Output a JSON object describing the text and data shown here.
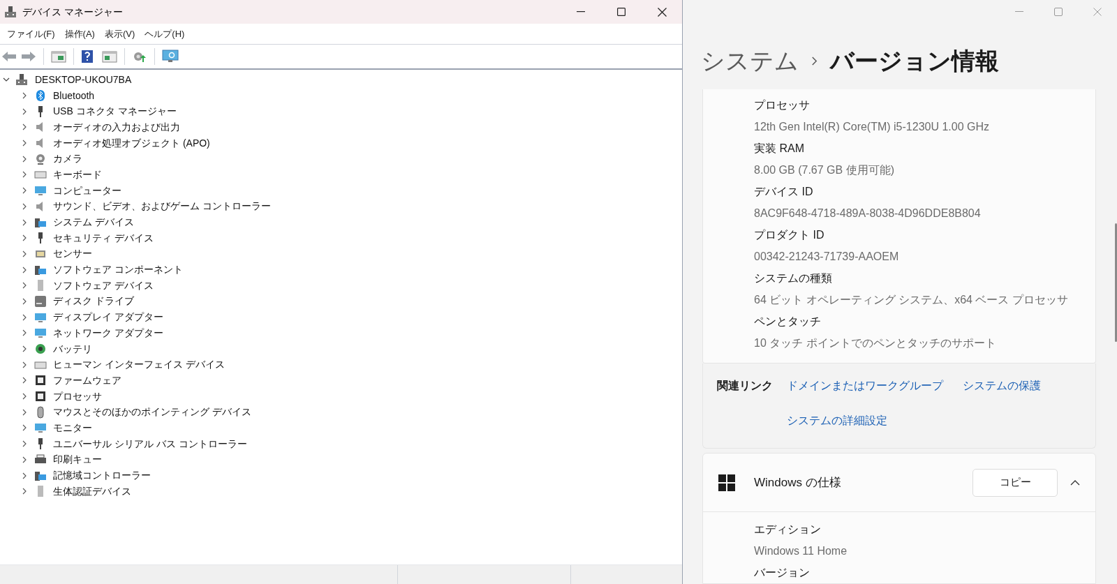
{
  "device_manager": {
    "window": {
      "title": "デバイス マネージャー"
    },
    "menu": [
      "ファイル(F)",
      "操作(A)",
      "表示(V)",
      "ヘルプ(H)"
    ],
    "tree": {
      "label": "DESKTOP-UKOU7BA",
      "expanded": true,
      "children": [
        {
          "label": "Bluetooth",
          "expanded": false
        },
        {
          "label": "USB コネクタ マネージャー",
          "expanded": false
        },
        {
          "label": "オーディオの入力および出力",
          "expanded": false
        },
        {
          "label": "オーディオ処理オブジェクト (APO)",
          "expanded": false
        },
        {
          "label": "カメラ",
          "expanded": false
        },
        {
          "label": "キーボード",
          "expanded": false
        },
        {
          "label": "コンピューター",
          "expanded": false
        },
        {
          "label": "サウンド、ビデオ、およびゲーム コントローラー",
          "expanded": false
        },
        {
          "label": "システム デバイス",
          "expanded": false
        },
        {
          "label": "セキュリティ デバイス",
          "expanded": false
        },
        {
          "label": "センサー",
          "expanded": false
        },
        {
          "label": "ソフトウェア コンポーネント",
          "expanded": false
        },
        {
          "label": "ソフトウェア デバイス",
          "expanded": false
        },
        {
          "label": "ディスク ドライブ",
          "expanded": false
        },
        {
          "label": "ディスプレイ アダプター",
          "expanded": false
        },
        {
          "label": "ネットワーク アダプター",
          "expanded": false
        },
        {
          "label": "バッテリ",
          "expanded": false
        },
        {
          "label": "ヒューマン インターフェイス デバイス",
          "expanded": false
        },
        {
          "label": "ファームウェア",
          "expanded": false
        },
        {
          "label": "プロセッサ",
          "expanded": false
        },
        {
          "label": "マウスとそのほかのポインティング デバイス",
          "expanded": false
        },
        {
          "label": "モニター",
          "expanded": false
        },
        {
          "label": "ユニバーサル シリアル バス コントローラー",
          "expanded": false
        },
        {
          "label": "印刷キュー",
          "expanded": false
        },
        {
          "label": "記憶域コントローラー",
          "expanded": false
        },
        {
          "label": "生体認証デバイス",
          "expanded": false
        }
      ]
    }
  },
  "settings": {
    "breadcrumb": [
      "システム",
      "バージョン情報"
    ],
    "device_specs": [
      {
        "label": "プロセッサ",
        "value": "12th Gen Intel(R) Core(TM) i5-1230U   1.00 GHz"
      },
      {
        "label": "実装 RAM",
        "value": "8.00 GB (7.67 GB 使用可能)"
      },
      {
        "label": "デバイス ID",
        "value": "8AC9F648-4718-489A-8038-4D96DDE8B804"
      },
      {
        "label": "プロダクト ID",
        "value": "00342-21243-71739-AAOEM"
      },
      {
        "label": "システムの種類",
        "value": "64 ビット オペレーティング システム、x64 ベース プロセッサ"
      },
      {
        "label": "ペンとタッチ",
        "value": "10 タッチ ポイントでのペンとタッチのサポート"
      }
    ],
    "related_links": {
      "label": "関連リンク",
      "links": [
        "ドメインまたはワークグループ",
        "システムの保護",
        "システムの詳細設定"
      ]
    },
    "windows_specs": {
      "title": "Windows の仕様",
      "copy_button": "コピー",
      "expanded": true,
      "rows": [
        {
          "label": "エディション",
          "value": "Windows 11 Home"
        },
        {
          "label": "バージョン"
        }
      ]
    }
  }
}
